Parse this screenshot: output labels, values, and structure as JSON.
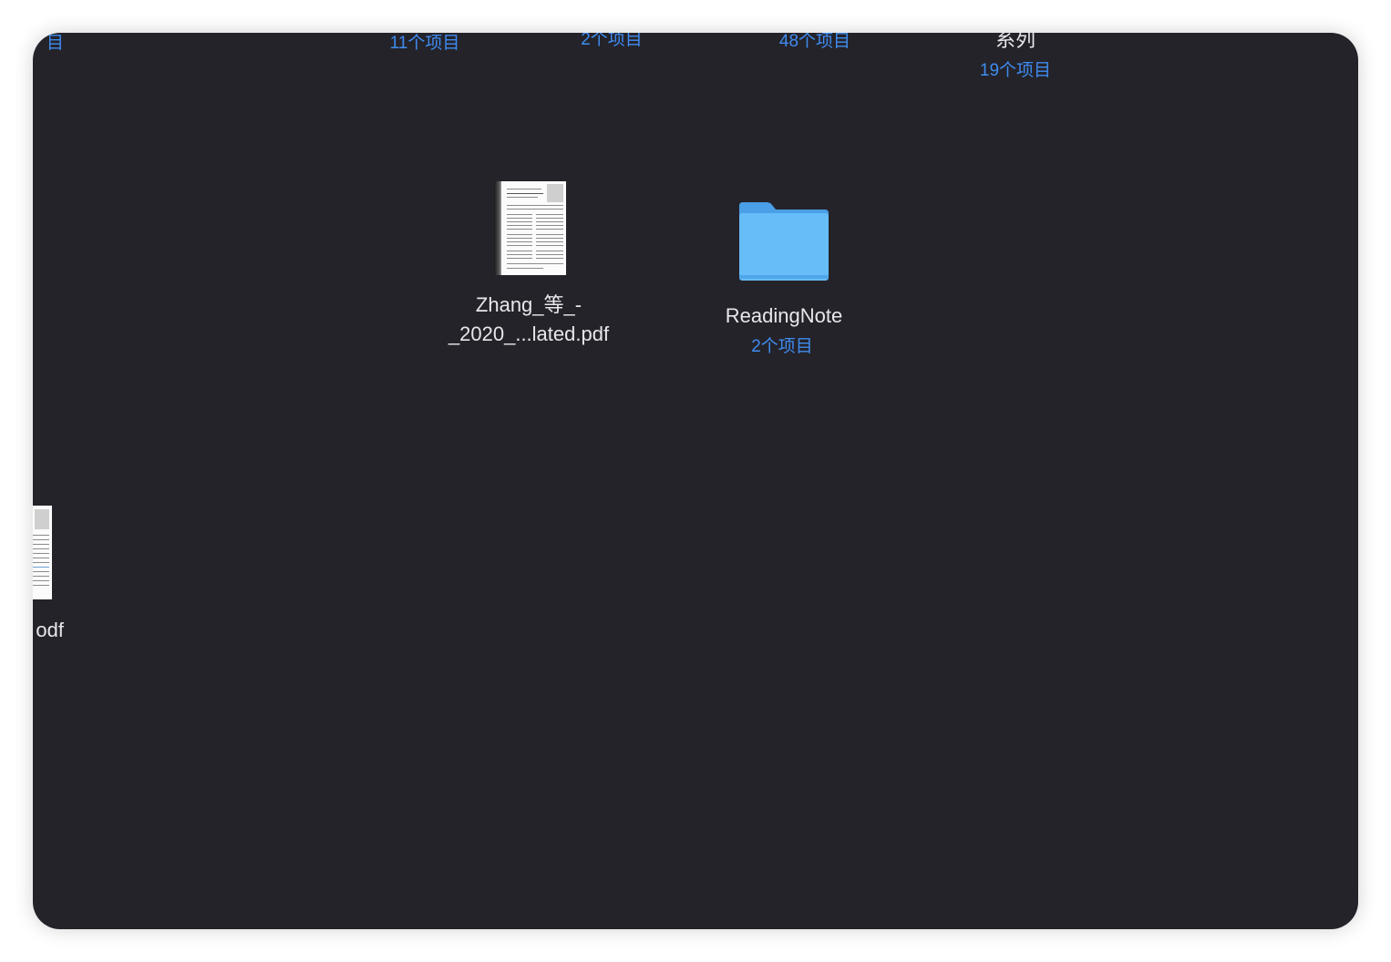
{
  "top_row": {
    "item1_count": "目",
    "item2_count": "11个项目",
    "item3_count": "2个项目",
    "item4_count": "48个项目",
    "item5_name": "系列",
    "item5_count": "19个项目"
  },
  "files": {
    "pdf_name_line1": "Zhang_等_-",
    "pdf_name_line2": "_2020_...lated.pdf",
    "pdf_icon": "pdf-document-icon"
  },
  "folders": {
    "reading_note_name": "ReadingNote",
    "reading_note_count": "2个项目",
    "folder_icon": "folder-icon",
    "folder_color": "#5ab0f2"
  },
  "left_partial": {
    "name_fragment": "odf"
  },
  "colors": {
    "window_bg": "#24232a",
    "count_text": "#3f8cf0",
    "name_text": "#e8e8ea"
  }
}
